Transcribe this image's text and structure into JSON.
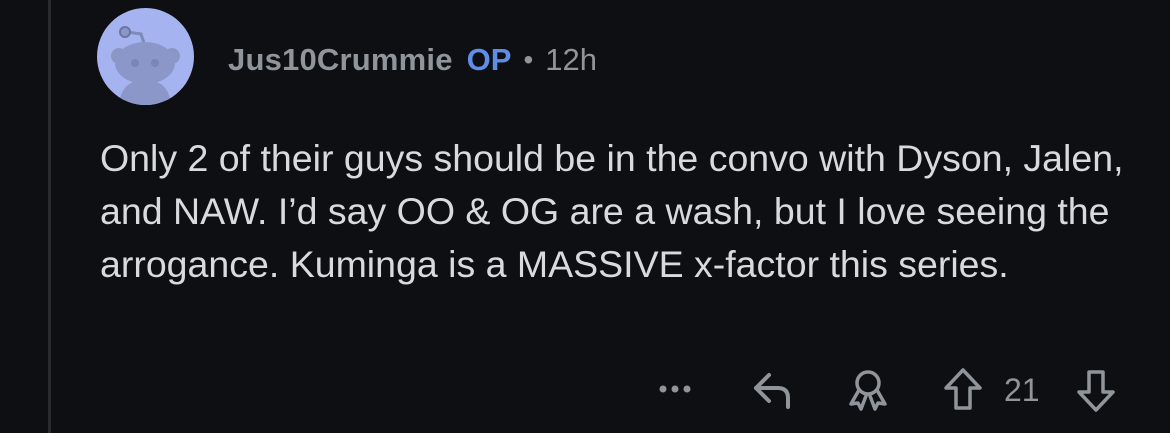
{
  "comment": {
    "author": "Jus10Crummie",
    "op_badge": "OP",
    "separator": "•",
    "timestamp": "12h",
    "body": "Only 2 of their guys should be in the convo with Dyson, Jalen, and NAW. I’d say OO & OG are a wash, but I love seeing the arrogance. Kuminga is a MASSIVE x-factor this series.",
    "score": "21"
  },
  "icons": {
    "avatar": "snoo-avatar-icon",
    "more": "more-options-icon",
    "reply": "reply-icon",
    "award": "award-icon",
    "upvote": "upvote-arrow-icon",
    "downvote": "downvote-arrow-icon"
  },
  "colors": {
    "background": "#0e0f12",
    "text": "#d9dadc",
    "muted": "#8f959b",
    "op_badge": "#5f8ee6",
    "avatar_bg": "#a5b3f0"
  }
}
